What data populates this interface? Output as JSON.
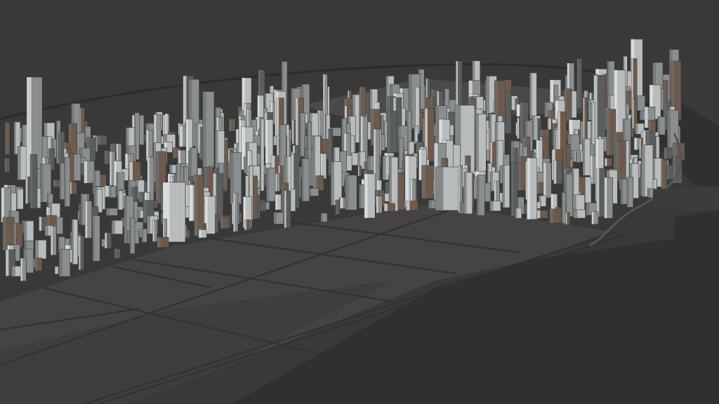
{
  "scene": {
    "subject": "3d-city-model-render",
    "colors": {
      "background": "#393939",
      "water_shadow": "#2f2f2f",
      "ground": "#434343",
      "road_lines": "#333333",
      "building_light": "#b8bcbc",
      "building_mid": "#8a8e8e",
      "building_dark": "#5a5d5d",
      "building_brown": "#6e5a4c",
      "highlight": "#e6e8e8"
    }
  }
}
